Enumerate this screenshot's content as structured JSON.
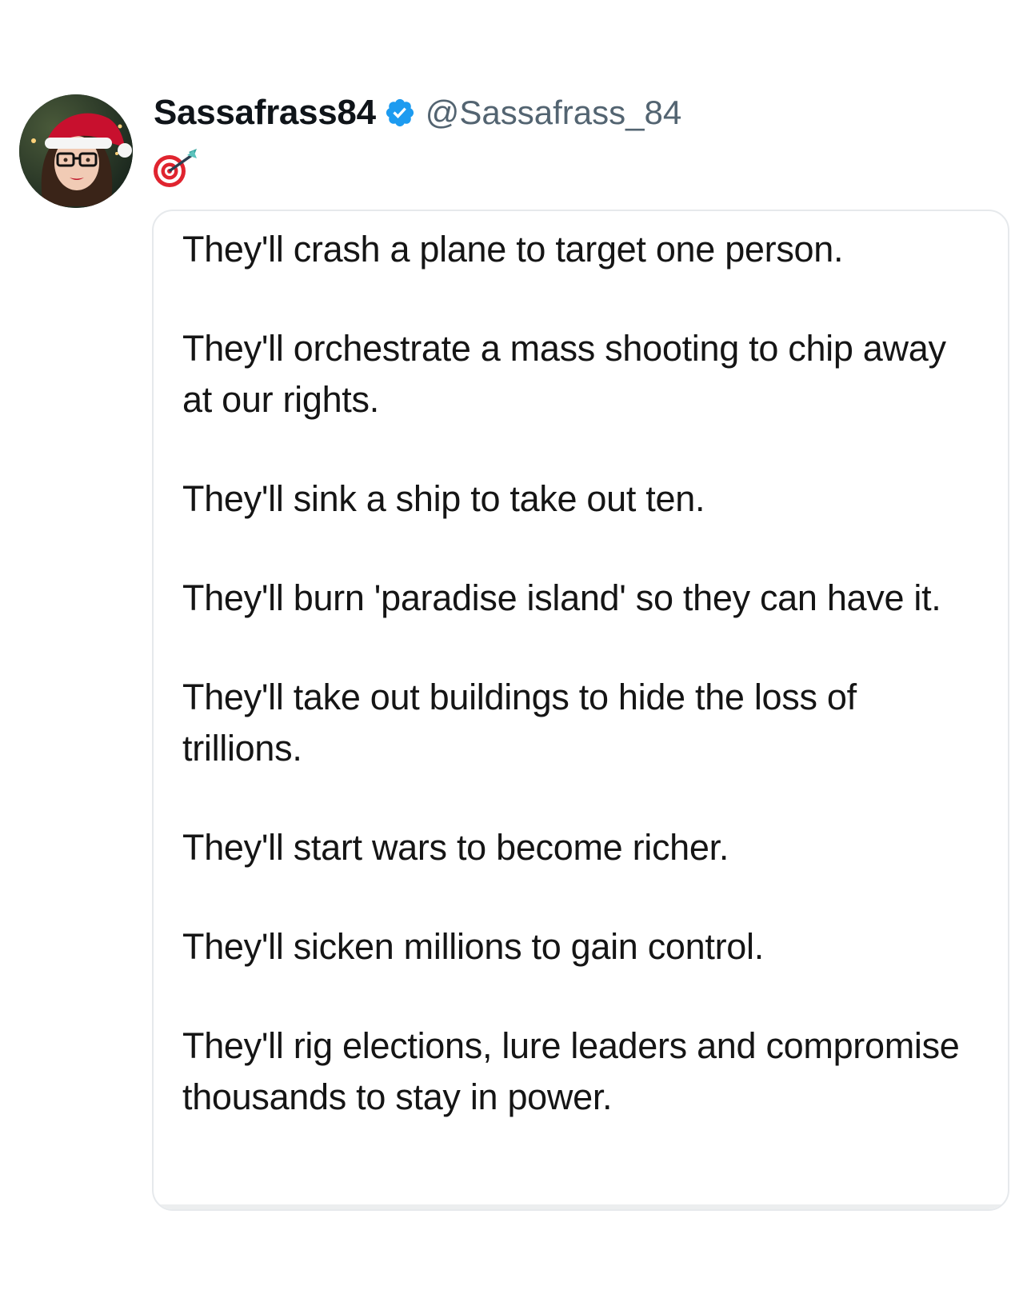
{
  "tweet": {
    "display_name": "Sassafrass84",
    "handle": "@Sassafrass_84",
    "verified_icon": "verified-badge-icon",
    "avatar": "avatar",
    "text_emoji": "direct-hit-target-icon"
  },
  "quoted_image": {
    "paragraphs": [
      "They'll crash a plane to target one person.",
      "They'll orchestrate a mass shooting to chip away at our rights.",
      "They'll sink a ship to take out ten.",
      "They'll burn 'paradise island' so they can have it.",
      "They'll take out buildings to hide the loss of trillions.",
      "They'll start wars to become richer.",
      "They'll sicken millions to gain control.",
      "They'll rig elections, lure leaders and compromise thousands to stay in power."
    ]
  },
  "colors": {
    "verified_blue": "#1d9bf0",
    "handle_gray": "#536471",
    "card_border": "#e6e9ec"
  }
}
